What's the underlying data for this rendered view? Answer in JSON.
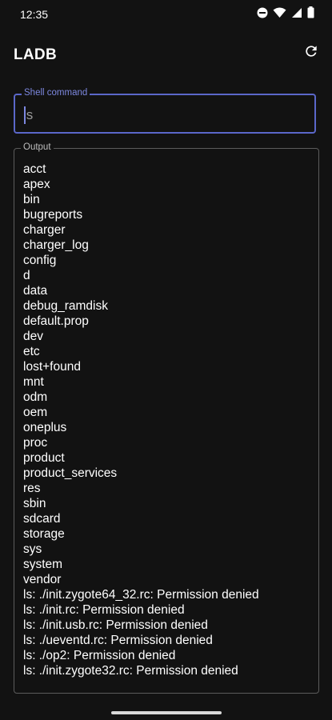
{
  "status_bar": {
    "time": "12:35",
    "icons": [
      "do-not-disturb-icon",
      "wifi-icon",
      "signal-icon",
      "battery-icon"
    ]
  },
  "app_bar": {
    "title": "LADB",
    "refresh_icon": "refresh-icon"
  },
  "shell_command": {
    "label": "Shell command",
    "value": "ls",
    "accent_color": "#5b67c9"
  },
  "output": {
    "label": "Output",
    "lines": [
      "acct",
      "apex",
      "bin",
      "bugreports",
      "charger",
      "charger_log",
      "config",
      "d",
      "data",
      "debug_ramdisk",
      "default.prop",
      "dev",
      "etc",
      "lost+found",
      "mnt",
      "odm",
      "oem",
      "oneplus",
      "proc",
      "product",
      "product_services",
      "res",
      "sbin",
      "sdcard",
      "storage",
      "sys",
      "system",
      "vendor",
      "ls: ./init.zygote64_32.rc: Permission denied",
      "ls: ./init.rc: Permission denied",
      "ls: ./init.usb.rc: Permission denied",
      "ls: ./ueventd.rc: Permission denied",
      "ls: ./op2: Permission denied",
      "ls: ./init.zygote32.rc: Permission denied"
    ]
  },
  "colors": {
    "background": "#121212",
    "text": "#ffffff",
    "accent": "#7d88e0"
  }
}
